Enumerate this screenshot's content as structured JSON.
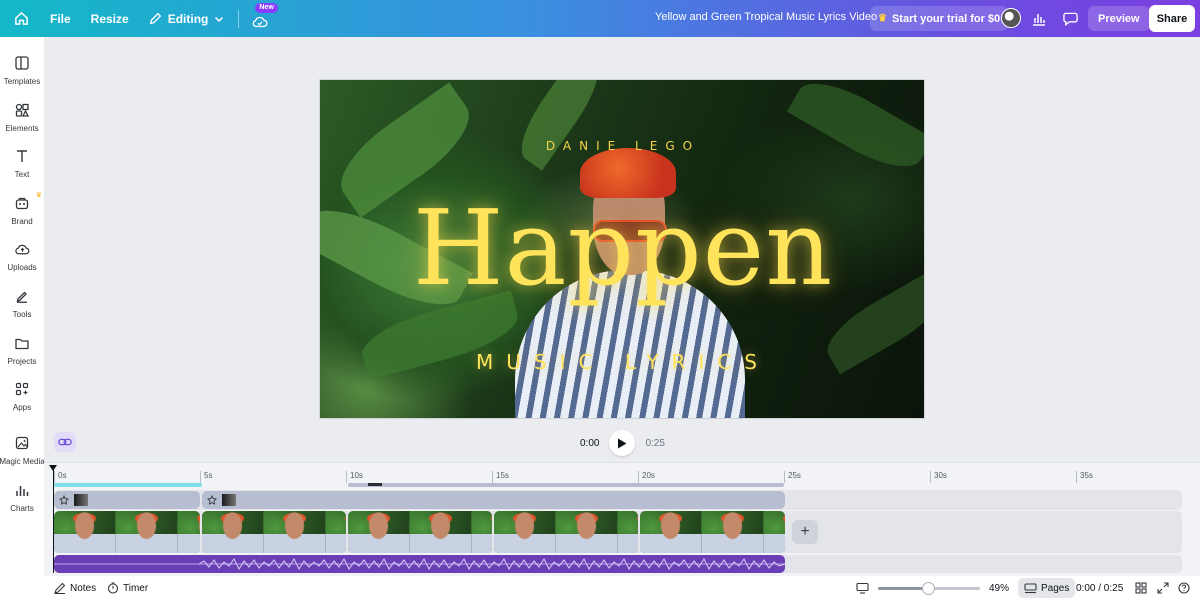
{
  "topbar": {
    "file_label": "File",
    "resize_label": "Resize",
    "editing_label": "Editing",
    "new_badge": "New",
    "doc_title": "Yellow and Green Tropical Music Lyrics Video",
    "trial_label": "Start your trial for $0",
    "preview_label": "Preview",
    "share_label": "Share"
  },
  "sidebar": {
    "items": [
      {
        "label": "Templates",
        "icon": "templates-icon"
      },
      {
        "label": "Elements",
        "icon": "elements-icon"
      },
      {
        "label": "Text",
        "icon": "text-icon"
      },
      {
        "label": "Brand",
        "icon": "brand-icon"
      },
      {
        "label": "Uploads",
        "icon": "uploads-icon"
      },
      {
        "label": "Tools",
        "icon": "tools-icon"
      },
      {
        "label": "Projects",
        "icon": "projects-icon"
      },
      {
        "label": "Apps",
        "icon": "apps-icon"
      },
      {
        "label": "Magic Media",
        "icon": "magic-media-icon"
      },
      {
        "label": "Charts",
        "icon": "charts-icon"
      }
    ]
  },
  "design": {
    "artist": "DANIE      LEGO",
    "title": "Happen",
    "subtitle": "MUSIC LYRICS"
  },
  "player": {
    "current_time": "0:00",
    "total_time": "0:25"
  },
  "timeline": {
    "ruler": [
      "0s",
      "5s",
      "10s",
      "15s",
      "20s",
      "25s",
      "30s",
      "35s"
    ]
  },
  "bottombar": {
    "notes_label": "Notes",
    "timer_label": "Timer",
    "zoom_level": "49%",
    "zoom_fraction": 0.49,
    "pages_label": "Pages",
    "time_readout": "0:00 / 0:25"
  },
  "colors": {
    "accent": "#8b3dff",
    "title_yellow": "#ffe35a",
    "audio_purple": "#6a3fb5"
  }
}
